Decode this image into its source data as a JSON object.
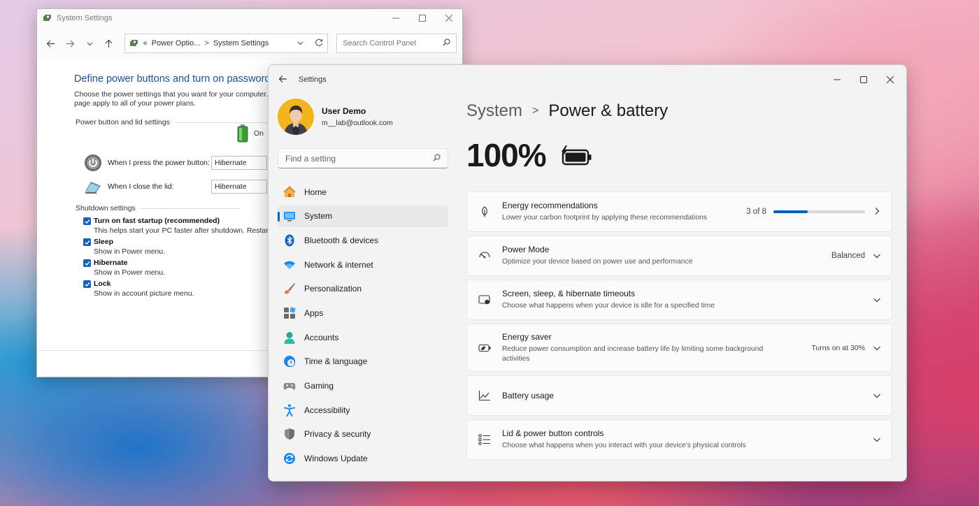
{
  "control_panel": {
    "title": "System Settings",
    "address": {
      "crumb_prefix": "«",
      "parent": "Power Optio...",
      "separator": ">",
      "current": "System Settings"
    },
    "search_placeholder": "Search Control Panel",
    "heading": "Define power buttons and turn on password p",
    "description_line1": "Choose the power settings that you want for your computer.",
    "description_line2": "page apply to all of your power plans.",
    "section_power": "Power button and lid settings",
    "on_label": "On",
    "power_button_label": "When I press the power button:",
    "power_button_value": "Hibernate",
    "lid_label": "When I close the lid:",
    "lid_value": "Hibernate",
    "section_shutdown": "Shutdown settings",
    "shutdown_items": [
      {
        "title": "Turn on fast startup (recommended)",
        "desc": "This helps start your PC faster after shutdown. Restart is"
      },
      {
        "title": "Sleep",
        "desc": "Show in Power menu."
      },
      {
        "title": "Hibernate",
        "desc": "Show in Power menu."
      },
      {
        "title": "Lock",
        "desc": "Show in account picture menu."
      }
    ]
  },
  "settings": {
    "app_title": "Settings",
    "user": {
      "name": "User Demo",
      "email": "m__lab@outlook.com"
    },
    "search_placeholder": "Find a setting",
    "nav": [
      {
        "label": "Home",
        "icon": "home-icon"
      },
      {
        "label": "System",
        "icon": "system-icon"
      },
      {
        "label": "Bluetooth & devices",
        "icon": "bluetooth-icon"
      },
      {
        "label": "Network & internet",
        "icon": "wifi-icon"
      },
      {
        "label": "Personalization",
        "icon": "brush-icon"
      },
      {
        "label": "Apps",
        "icon": "apps-icon"
      },
      {
        "label": "Accounts",
        "icon": "accounts-icon"
      },
      {
        "label": "Time & language",
        "icon": "globe-clock-icon"
      },
      {
        "label": "Gaming",
        "icon": "gamepad-icon"
      },
      {
        "label": "Accessibility",
        "icon": "accessibility-icon"
      },
      {
        "label": "Privacy & security",
        "icon": "shield-icon"
      },
      {
        "label": "Windows Update",
        "icon": "update-icon"
      }
    ],
    "breadcrumb": {
      "parent": "System",
      "separator": ">",
      "current": "Power & battery"
    },
    "battery_percent": "100%",
    "cards": [
      {
        "title": "Energy recommendations",
        "sub": "Lower your carbon footprint by applying these recommendations",
        "value": "3 of 8",
        "progress": 0.375,
        "icon": "leaf-icon"
      },
      {
        "title": "Power Mode",
        "sub": "Optimize your device based on power use and performance",
        "value": "Balanced",
        "icon": "gauge-icon"
      },
      {
        "title": "Screen, sleep, & hibernate timeouts",
        "sub": "Choose what happens when your device is idle for a specified time",
        "value": "",
        "icon": "screen-sleep-icon"
      },
      {
        "title": "Energy saver",
        "sub": "Reduce power consumption and increase battery life by limiting some background activities",
        "value": "Turns on at 30%",
        "icon": "battery-saver-icon"
      },
      {
        "title": "Battery usage",
        "sub": "",
        "value": "",
        "icon": "chart-line-icon"
      },
      {
        "title": "Lid & power button controls",
        "sub": "Choose what happens when you interact with your device's physical controls",
        "value": "",
        "icon": "list-icon"
      }
    ],
    "accent": "#0a5fb4"
  }
}
